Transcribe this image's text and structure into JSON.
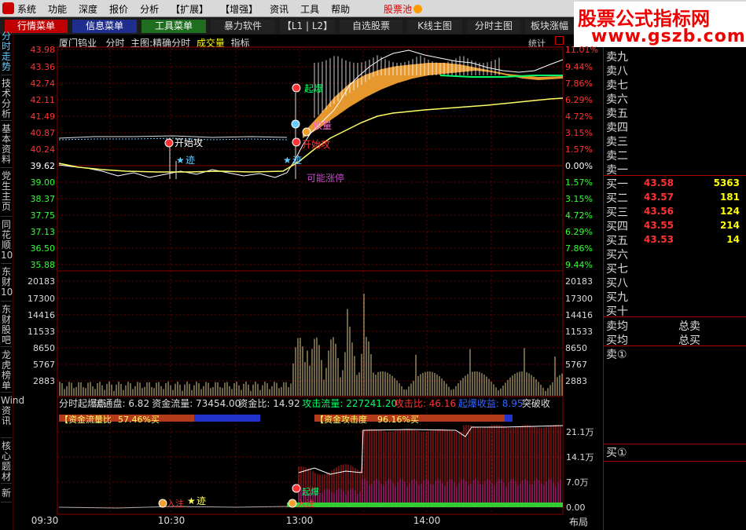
{
  "menubar": {
    "items": [
      "系统",
      "功能",
      "深度",
      "报价",
      "分析",
      "【扩展】",
      "【增强】",
      "资讯",
      "工具",
      "帮助"
    ],
    "pool": "股票池"
  },
  "brand": {
    "line1": "股票公式指标网",
    "line2": "www.gszb.com"
  },
  "toolbar": {
    "items": [
      {
        "label": "行情菜单",
        "bg": "#c00000",
        "color": "#ffffff"
      },
      {
        "label": "信息菜单",
        "bg": "#1f2e8c",
        "color": "#ffffff"
      },
      {
        "label": "工具菜单",
        "bg": "#1f6e1f",
        "color": "#ffffff"
      },
      {
        "label": "暴力软件",
        "bg": "#222222",
        "color": "#dddddd"
      },
      {
        "label": "【L1 | L2】",
        "bg": "#222222",
        "color": "#dddddd"
      },
      {
        "label": "自选股票",
        "bg": "#222222",
        "color": "#dddddd"
      },
      {
        "label": "K线主图",
        "bg": "#222222",
        "color": "#dddddd"
      },
      {
        "label": "分时主图",
        "bg": "#222222",
        "color": "#dddddd"
      },
      {
        "label": "板块涨幅",
        "bg": "#222222",
        "color": "#dddddd"
      }
    ]
  },
  "vnav": [
    "分时走势",
    "技术分析",
    "基本资料",
    "党生主页",
    "同花顺10",
    "东财10",
    "东财股吧",
    "龙虎榜单",
    "Wind资讯",
    "核心题材",
    "新"
  ],
  "title": {
    "stock": "厦门钨业",
    "mode": "分时",
    "main": "主图:精确分时",
    "volume": "成交量",
    "indicator": "指标",
    "stats": "统计"
  },
  "price_axis": {
    "left": [
      "43.98",
      "43.36",
      "42.74",
      "42.11",
      "41.49",
      "40.87",
      "40.24",
      "39.62",
      "39.00",
      "38.37",
      "37.75",
      "37.13",
      "36.50",
      "35.88"
    ],
    "right": [
      "11.01%",
      "9.44%",
      "7.86%",
      "6.29%",
      "4.72%",
      "3.15%",
      "1.57%",
      "0.00%",
      "1.57%",
      "3.15%",
      "4.72%",
      "6.29%",
      "7.86%",
      "9.44%"
    ],
    "base": "39.62"
  },
  "volume_axis": [
    "20183",
    "17300",
    "14416",
    "11533",
    "8650",
    "5767",
    "2883"
  ],
  "signals_main": {
    "start_attack_1": "开始攻",
    "star_1": "迹",
    "qibao": "起爆",
    "fangliang": "放量",
    "start_attack_2": "开始攻",
    "star_2": "迹",
    "possible_limit": "可能涨停"
  },
  "indicator": {
    "header": [
      {
        "text": "分时起爆点",
        "color": "#dddddd"
      },
      {
        "text": "流通盘: 6.82",
        "color": "#dddddd"
      },
      {
        "text": "资金流量: 73454.00",
        "color": "#dddddd"
      },
      {
        "text": "资金比: 14.92",
        "color": "#dddddd"
      },
      {
        "text": "攻击流量: 227241.20",
        "color": "#00ff66"
      },
      {
        "text": "攻击比: 46.16",
        "color": "#ff3333"
      },
      {
        "text": "起爆收益: 8.95",
        "color": "#3366ff"
      },
      {
        "text": "突破收",
        "color": "#dddddd"
      }
    ],
    "flow_box": {
      "label": "【资金流量比",
      "value": "57.46%买"
    },
    "attack_box": {
      "label": "【资金攻击度",
      "value": "96.16%买"
    },
    "axis": [
      "21.1万",
      "14.1万",
      "7.0万",
      "0.00"
    ],
    "signals": {
      "ant": "入注",
      "star": "迹",
      "qibao": "起爆",
      "ant2": "入注"
    }
  },
  "time_axis": [
    "09:30",
    "10:30",
    "13:00",
    "14:00"
  ],
  "layout_btn": "布局",
  "orderbook": {
    "sells": [
      "卖九",
      "卖八",
      "卖七",
      "卖六",
      "卖五",
      "卖四",
      "卖三",
      "卖二",
      "卖一"
    ],
    "buys": [
      {
        "label": "买一",
        "price": "43.58",
        "vol": "5363"
      },
      {
        "label": "买二",
        "price": "43.57",
        "vol": "181"
      },
      {
        "label": "买三",
        "price": "43.56",
        "vol": "124"
      },
      {
        "label": "买四",
        "price": "43.55",
        "vol": "214"
      },
      {
        "label": "买五",
        "price": "43.53",
        "vol": "14"
      },
      {
        "label": "买六",
        "price": "",
        "vol": ""
      },
      {
        "label": "买七",
        "price": "",
        "vol": ""
      },
      {
        "label": "买八",
        "price": "",
        "vol": ""
      },
      {
        "label": "买九",
        "price": "",
        "vol": ""
      },
      {
        "label": "买十",
        "price": "",
        "vol": ""
      }
    ],
    "sell_avg": "卖均",
    "total_sell": "总卖",
    "buy_avg": "买均",
    "total_buy": "总买",
    "sell_one_circled": "卖①",
    "buy_one_circled": "买①"
  },
  "colors": {
    "up": "#ff3333",
    "down": "#33ff33",
    "price_line": "#ffffff",
    "avg_line": "#ffff66",
    "band_fill": "#f0a030",
    "grid": "#8b0000"
  }
}
